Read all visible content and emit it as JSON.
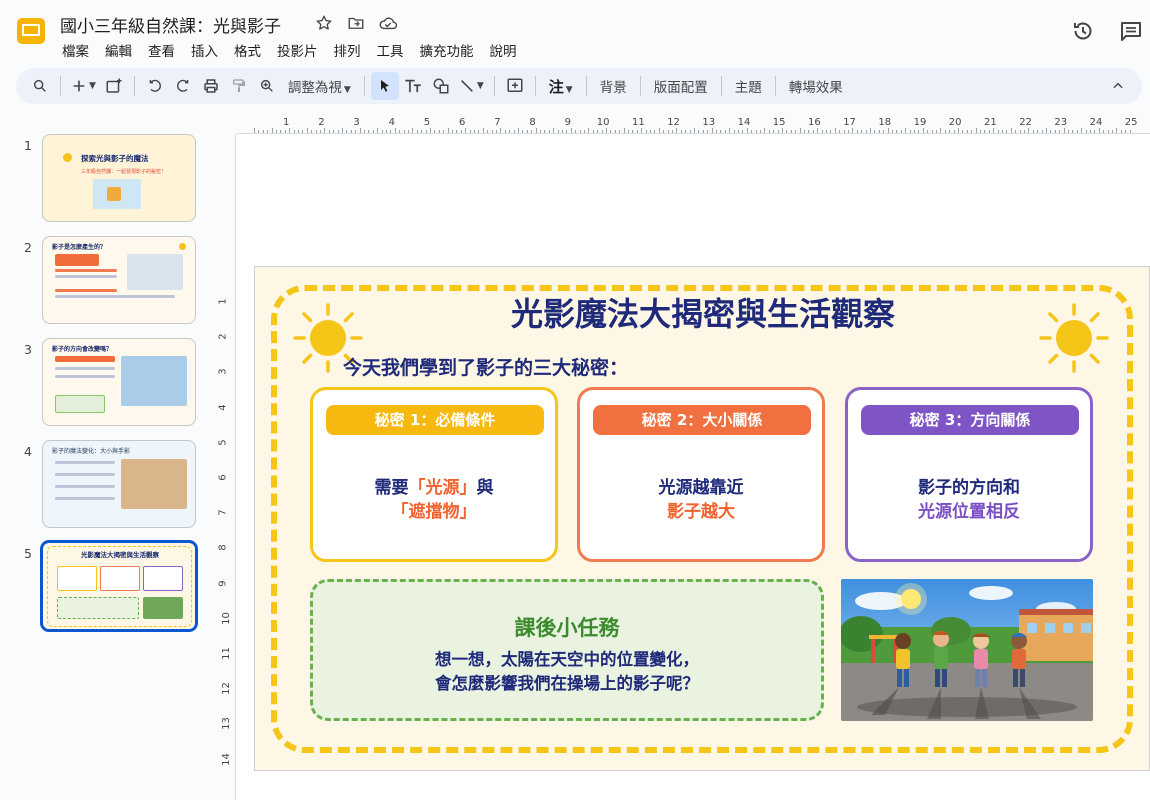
{
  "app": {
    "doc_title": "國小三年級自然課：光與影子",
    "menu": [
      "檔案",
      "編輯",
      "查看",
      "插入",
      "格式",
      "投影片",
      "排列",
      "工具",
      "擴充功能",
      "說明"
    ]
  },
  "toolbar": {
    "zoom_label": "調整為視",
    "notes_label": "注",
    "background_label": "背景",
    "layout_label": "版面配置",
    "theme_label": "主題",
    "transition_label": "轉場效果"
  },
  "ruler": {
    "top": [
      "1",
      "2",
      "3",
      "4",
      "5",
      "6",
      "7",
      "8",
      "9",
      "10",
      "11",
      "12",
      "13",
      "14",
      "15",
      "16",
      "17",
      "18",
      "19",
      "20",
      "21",
      "22",
      "23",
      "24",
      "25"
    ],
    "left": [
      "1",
      "2",
      "3",
      "4",
      "5",
      "6",
      "7",
      "8",
      "9",
      "10",
      "11",
      "12",
      "13",
      "14"
    ]
  },
  "thumbnails": [
    {
      "num": "1",
      "title": "探索光與影子的魔法",
      "sub": "三年級自然課：一起發現影子的秘密！"
    },
    {
      "num": "2",
      "title": "影子是怎麼產生的？"
    },
    {
      "num": "3",
      "title": "影子的方向會改變嗎？"
    },
    {
      "num": "4",
      "title": "影子的魔法變化：大小與手影"
    },
    {
      "num": "5",
      "title": "光影魔法大揭密與生活觀察"
    }
  ],
  "slide": {
    "title": "光影魔法大揭密與生活觀察",
    "subtitle": "今天我們學到了影子的三大秘密：",
    "cards": [
      {
        "head": "秘密 1：必備條件",
        "line1_a": "需要",
        "line1_b": "「光源」",
        "line1_c": "與",
        "line2": "「遮擋物」",
        "color": "#f5c518",
        "head_color": "#f7b90f"
      },
      {
        "head": "秘密 2：大小關係",
        "line1": "光源越靠近",
        "line2": "影子越大",
        "color": "#f07b4f",
        "head_color": "#f0703f"
      },
      {
        "head": "秘密 3：方向關係",
        "line1": "影子的方向和",
        "line2": "光源位置相反",
        "color": "#8a63c9",
        "head_color": "#7f55c6"
      }
    ],
    "task": {
      "title": "課後小任務",
      "line1": "想一想，太陽在天空中的位置變化，",
      "line2": "會怎麼影響我們在操場上的影子呢？"
    }
  }
}
